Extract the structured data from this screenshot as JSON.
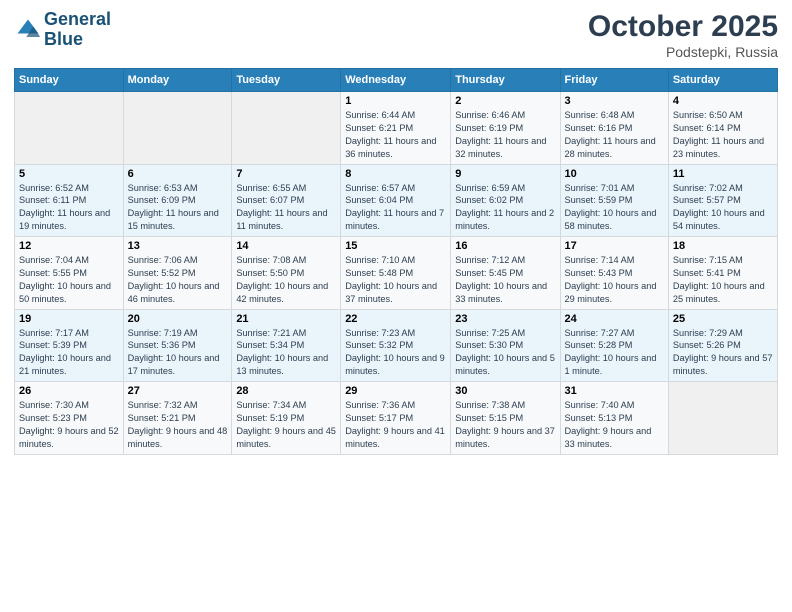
{
  "header": {
    "logo_line1": "General",
    "logo_line2": "Blue",
    "month": "October 2025",
    "location": "Podstepki, Russia"
  },
  "weekdays": [
    "Sunday",
    "Monday",
    "Tuesday",
    "Wednesday",
    "Thursday",
    "Friday",
    "Saturday"
  ],
  "weeks": [
    [
      {
        "day": "",
        "sunrise": "",
        "sunset": "",
        "daylight": ""
      },
      {
        "day": "",
        "sunrise": "",
        "sunset": "",
        "daylight": ""
      },
      {
        "day": "",
        "sunrise": "",
        "sunset": "",
        "daylight": ""
      },
      {
        "day": "1",
        "sunrise": "Sunrise: 6:44 AM",
        "sunset": "Sunset: 6:21 PM",
        "daylight": "Daylight: 11 hours and 36 minutes."
      },
      {
        "day": "2",
        "sunrise": "Sunrise: 6:46 AM",
        "sunset": "Sunset: 6:19 PM",
        "daylight": "Daylight: 11 hours and 32 minutes."
      },
      {
        "day": "3",
        "sunrise": "Sunrise: 6:48 AM",
        "sunset": "Sunset: 6:16 PM",
        "daylight": "Daylight: 11 hours and 28 minutes."
      },
      {
        "day": "4",
        "sunrise": "Sunrise: 6:50 AM",
        "sunset": "Sunset: 6:14 PM",
        "daylight": "Daylight: 11 hours and 23 minutes."
      }
    ],
    [
      {
        "day": "5",
        "sunrise": "Sunrise: 6:52 AM",
        "sunset": "Sunset: 6:11 PM",
        "daylight": "Daylight: 11 hours and 19 minutes."
      },
      {
        "day": "6",
        "sunrise": "Sunrise: 6:53 AM",
        "sunset": "Sunset: 6:09 PM",
        "daylight": "Daylight: 11 hours and 15 minutes."
      },
      {
        "day": "7",
        "sunrise": "Sunrise: 6:55 AM",
        "sunset": "Sunset: 6:07 PM",
        "daylight": "Daylight: 11 hours and 11 minutes."
      },
      {
        "day": "8",
        "sunrise": "Sunrise: 6:57 AM",
        "sunset": "Sunset: 6:04 PM",
        "daylight": "Daylight: 11 hours and 7 minutes."
      },
      {
        "day": "9",
        "sunrise": "Sunrise: 6:59 AM",
        "sunset": "Sunset: 6:02 PM",
        "daylight": "Daylight: 11 hours and 2 minutes."
      },
      {
        "day": "10",
        "sunrise": "Sunrise: 7:01 AM",
        "sunset": "Sunset: 5:59 PM",
        "daylight": "Daylight: 10 hours and 58 minutes."
      },
      {
        "day": "11",
        "sunrise": "Sunrise: 7:02 AM",
        "sunset": "Sunset: 5:57 PM",
        "daylight": "Daylight: 10 hours and 54 minutes."
      }
    ],
    [
      {
        "day": "12",
        "sunrise": "Sunrise: 7:04 AM",
        "sunset": "Sunset: 5:55 PM",
        "daylight": "Daylight: 10 hours and 50 minutes."
      },
      {
        "day": "13",
        "sunrise": "Sunrise: 7:06 AM",
        "sunset": "Sunset: 5:52 PM",
        "daylight": "Daylight: 10 hours and 46 minutes."
      },
      {
        "day": "14",
        "sunrise": "Sunrise: 7:08 AM",
        "sunset": "Sunset: 5:50 PM",
        "daylight": "Daylight: 10 hours and 42 minutes."
      },
      {
        "day": "15",
        "sunrise": "Sunrise: 7:10 AM",
        "sunset": "Sunset: 5:48 PM",
        "daylight": "Daylight: 10 hours and 37 minutes."
      },
      {
        "day": "16",
        "sunrise": "Sunrise: 7:12 AM",
        "sunset": "Sunset: 5:45 PM",
        "daylight": "Daylight: 10 hours and 33 minutes."
      },
      {
        "day": "17",
        "sunrise": "Sunrise: 7:14 AM",
        "sunset": "Sunset: 5:43 PM",
        "daylight": "Daylight: 10 hours and 29 minutes."
      },
      {
        "day": "18",
        "sunrise": "Sunrise: 7:15 AM",
        "sunset": "Sunset: 5:41 PM",
        "daylight": "Daylight: 10 hours and 25 minutes."
      }
    ],
    [
      {
        "day": "19",
        "sunrise": "Sunrise: 7:17 AM",
        "sunset": "Sunset: 5:39 PM",
        "daylight": "Daylight: 10 hours and 21 minutes."
      },
      {
        "day": "20",
        "sunrise": "Sunrise: 7:19 AM",
        "sunset": "Sunset: 5:36 PM",
        "daylight": "Daylight: 10 hours and 17 minutes."
      },
      {
        "day": "21",
        "sunrise": "Sunrise: 7:21 AM",
        "sunset": "Sunset: 5:34 PM",
        "daylight": "Daylight: 10 hours and 13 minutes."
      },
      {
        "day": "22",
        "sunrise": "Sunrise: 7:23 AM",
        "sunset": "Sunset: 5:32 PM",
        "daylight": "Daylight: 10 hours and 9 minutes."
      },
      {
        "day": "23",
        "sunrise": "Sunrise: 7:25 AM",
        "sunset": "Sunset: 5:30 PM",
        "daylight": "Daylight: 10 hours and 5 minutes."
      },
      {
        "day": "24",
        "sunrise": "Sunrise: 7:27 AM",
        "sunset": "Sunset: 5:28 PM",
        "daylight": "Daylight: 10 hours and 1 minute."
      },
      {
        "day": "25",
        "sunrise": "Sunrise: 7:29 AM",
        "sunset": "Sunset: 5:26 PM",
        "daylight": "Daylight: 9 hours and 57 minutes."
      }
    ],
    [
      {
        "day": "26",
        "sunrise": "Sunrise: 7:30 AM",
        "sunset": "Sunset: 5:23 PM",
        "daylight": "Daylight: 9 hours and 52 minutes."
      },
      {
        "day": "27",
        "sunrise": "Sunrise: 7:32 AM",
        "sunset": "Sunset: 5:21 PM",
        "daylight": "Daylight: 9 hours and 48 minutes."
      },
      {
        "day": "28",
        "sunrise": "Sunrise: 7:34 AM",
        "sunset": "Sunset: 5:19 PM",
        "daylight": "Daylight: 9 hours and 45 minutes."
      },
      {
        "day": "29",
        "sunrise": "Sunrise: 7:36 AM",
        "sunset": "Sunset: 5:17 PM",
        "daylight": "Daylight: 9 hours and 41 minutes."
      },
      {
        "day": "30",
        "sunrise": "Sunrise: 7:38 AM",
        "sunset": "Sunset: 5:15 PM",
        "daylight": "Daylight: 9 hours and 37 minutes."
      },
      {
        "day": "31",
        "sunrise": "Sunrise: 7:40 AM",
        "sunset": "Sunset: 5:13 PM",
        "daylight": "Daylight: 9 hours and 33 minutes."
      },
      {
        "day": "",
        "sunrise": "",
        "sunset": "",
        "daylight": ""
      }
    ]
  ]
}
